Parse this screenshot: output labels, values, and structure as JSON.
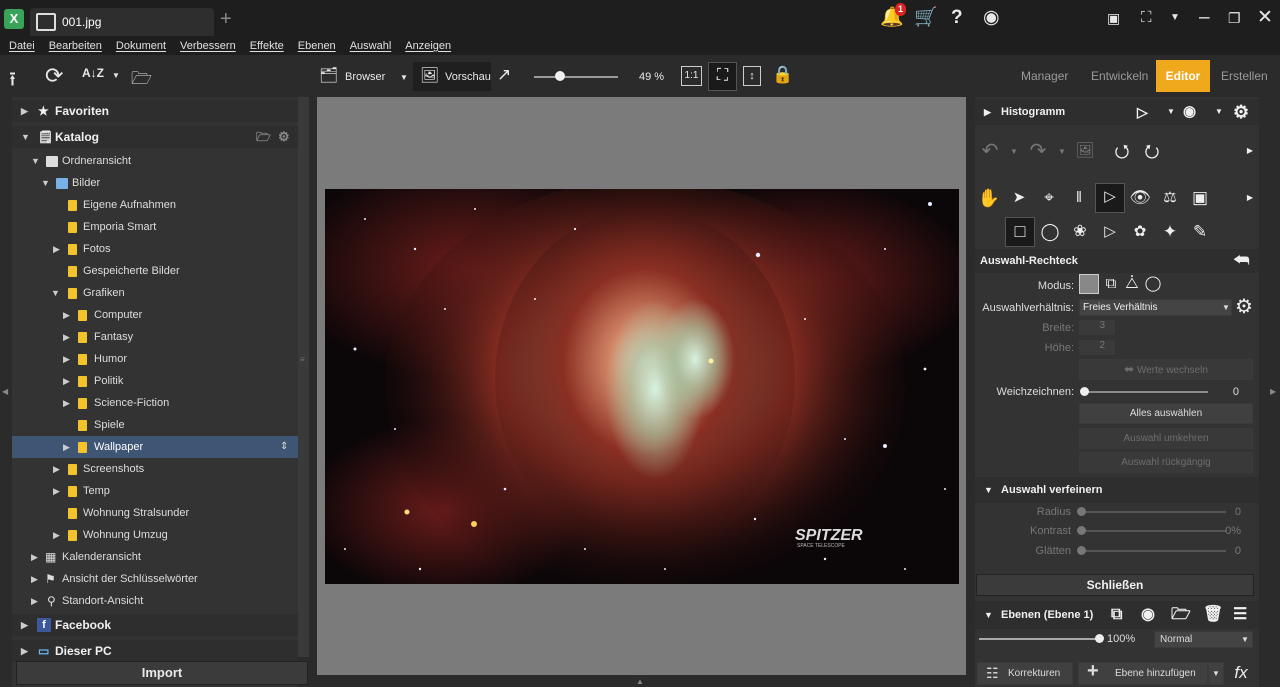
{
  "titlebar": {
    "tab_name": "001.jpg",
    "notification_count": "1"
  },
  "menu": [
    "Datei",
    "Bearbeiten",
    "Dokument",
    "Verbessern",
    "Effekte",
    "Ebenen",
    "Auswahl",
    "Anzeigen"
  ],
  "toolbar": {
    "browser_label": "Browser",
    "preview_label": "Vorschau",
    "zoom_percent": "49 %",
    "zoom_level": 0.27,
    "one_to_one": "1:1"
  },
  "modes": {
    "manager": "Manager",
    "develop": "Entwickeln",
    "editor": "Editor",
    "create": "Erstellen"
  },
  "tree": {
    "favorites": "Favoriten",
    "catalog": "Katalog",
    "folder_view": "Ordneransicht",
    "pictures": "Bilder",
    "items": [
      {
        "label": "Eigene Aufnahmen"
      },
      {
        "label": "Emporia Smart"
      },
      {
        "label": "Fotos"
      },
      {
        "label": "Gespeicherte Bilder"
      },
      {
        "label": "Grafiken"
      },
      {
        "label": "Computer"
      },
      {
        "label": "Fantasy"
      },
      {
        "label": "Humor"
      },
      {
        "label": "Politik"
      },
      {
        "label": "Science-Fiction"
      },
      {
        "label": "Spiele"
      },
      {
        "label": "Wallpaper"
      },
      {
        "label": "Screenshots"
      },
      {
        "label": "Temp"
      },
      {
        "label": "Wohnung Stralsunder"
      },
      {
        "label": "Wohnung Umzug"
      }
    ],
    "calendar_view": "Kalenderansicht",
    "keywords_view": "Ansicht der Schlüsselwörter",
    "location_view": "Standort-Ansicht",
    "facebook": "Facebook",
    "this_pc": "Dieser PC",
    "import": "Import"
  },
  "image": {
    "watermark_title": "SPITZER",
    "watermark_sub": "SPACE TELESCOPE"
  },
  "right": {
    "histogram": "Histogramm",
    "tool_title": "Auswahl-Rechteck",
    "mode_label": "Modus:",
    "ratio_label": "Auswahlverhältnis:",
    "ratio_value": "Freies Verhältnis",
    "width_label": "Breite:",
    "width_value": "3",
    "height_label": "Höhe:",
    "height_value": "2",
    "swap_label": "Werte wechseln",
    "feather_label": "Weichzeichnen:",
    "feather_value": "0",
    "select_all": "Alles auswählen",
    "invert": "Auswahl umkehren",
    "undo_sel": "Auswahl rückgängig",
    "refine": "Auswahl verfeinern",
    "radius_label": "Radius",
    "radius_value": "0",
    "contrast_label": "Kontrast",
    "contrast_value": "0%",
    "smooth_label": "Glätten",
    "smooth_value": "0",
    "close": "Schließen",
    "layers": "Ebenen (Ebene 1)",
    "opacity": "100%",
    "blend": "Normal",
    "corrections": "Korrekturen",
    "add_layer": "Ebene hinzufügen",
    "fx": "fx"
  },
  "colors": {
    "accent": "#f0a81c",
    "selection": "#3f5574",
    "folder": "#f2c32c"
  }
}
